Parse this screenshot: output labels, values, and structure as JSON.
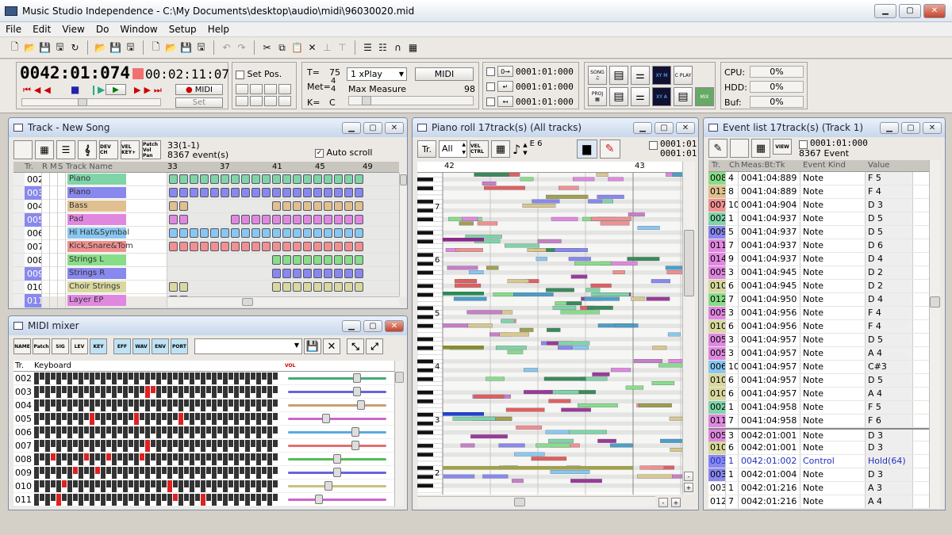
{
  "app": {
    "title": "Music Studio Independence - C:\\My Documents\\desktop\\audio\\midi\\96030020.mid",
    "menu": [
      "File",
      "Edit",
      "View",
      "Do",
      "Window",
      "Setup",
      "Help"
    ]
  },
  "transport": {
    "position": "0042:01:074",
    "time": "00:02:11:07",
    "midi_label": "MIDI",
    "set_label": "Set",
    "set_pos_label": "Set Pos.",
    "tempo_label": "T=",
    "tempo": "75",
    "meter_label": "Met=",
    "meter_top": "4",
    "meter_bottom": "4",
    "key_label": "K=",
    "key": "C",
    "play_mode": "1 xPlay",
    "midi_button": "MIDI",
    "max_measure_label": "Max Measure",
    "max_measure": "98",
    "loc1": "0001:01:000",
    "loc2": "0001:01:000",
    "loc3": "0001:01:000",
    "cpu_label": "CPU:",
    "cpu": "0%",
    "hdd_label": "HDD:",
    "hdd": "0%",
    "buf_label": "Buf:",
    "buf": "0%",
    "view_buttons": [
      "SONG",
      "PROJ",
      "C PLAY",
      "XY M",
      "XY A",
      "MIX"
    ]
  },
  "track_window": {
    "title": "Track - New Song",
    "position": "33(1-1)",
    "events": "8367 event(s)",
    "auto_scroll": "Auto scroll",
    "tool_buttons": [
      "DEV CH",
      "VEL KEY+",
      "Patch Vol Pan"
    ],
    "columns": [
      "Tr.",
      "R",
      "M",
      "S",
      "Track Name"
    ],
    "measures": [
      "33",
      "37",
      "41",
      "45",
      "49"
    ],
    "tracks": [
      {
        "no": "002",
        "name": "Piano",
        "color": "#7fd4a8",
        "sel": false
      },
      {
        "no": "003",
        "name": "Piano",
        "color": "#8888ee",
        "sel": true
      },
      {
        "no": "004",
        "name": "Bass",
        "color": "#e0c090",
        "sel": false
      },
      {
        "no": "005",
        "name": "Pad",
        "color": "#e088e0",
        "sel": true
      },
      {
        "no": "006",
        "name": "Hi Hat&Symbal",
        "color": "#88c8f0",
        "sel": false
      },
      {
        "no": "007",
        "name": "Kick,Snare&Tom",
        "color": "#f09090",
        "sel": false
      },
      {
        "no": "008",
        "name": "Strings L",
        "color": "#88dd88",
        "sel": false
      },
      {
        "no": "009",
        "name": "Strings R",
        "color": "#8888ee",
        "sel": true
      },
      {
        "no": "010",
        "name": "Choir Strings",
        "color": "#d8d8a0",
        "sel": false
      },
      {
        "no": "011",
        "name": "Layer EP",
        "color": "#e088e0",
        "sel": true
      }
    ]
  },
  "mixer": {
    "title": "MIDI mixer",
    "buttons": [
      "NAME",
      "Patch",
      "SIG",
      "LEV",
      "KEY",
      "EFF",
      "WAV",
      "ENV",
      "PORT"
    ],
    "columns": [
      "Tr.",
      "Keyboard"
    ],
    "vol_label": "VOL",
    "tracks": [
      "002",
      "003",
      "004",
      "005",
      "006",
      "007",
      "008",
      "009",
      "010",
      "011"
    ],
    "faders": [
      {
        "color": "#44aa77",
        "level": 0.72
      },
      {
        "color": "#6666dd",
        "level": 0.72
      },
      {
        "color": "#c8a070",
        "level": 0.76
      },
      {
        "color": "#cc66cc",
        "level": 0.38
      },
      {
        "color": "#5aaae0",
        "level": 0.7
      },
      {
        "color": "#e07070",
        "level": 0.7
      },
      {
        "color": "#55bb55",
        "level": 0.5
      },
      {
        "color": "#6666dd",
        "level": 0.5
      },
      {
        "color": "#c8c080",
        "level": 0.4
      },
      {
        "color": "#cc66cc",
        "level": 0.3
      }
    ]
  },
  "piano_roll": {
    "title": "Piano roll 17track(s) (All tracks)",
    "track_button": "Tr.",
    "filter": "All",
    "note": "E 6",
    "pos1": "0001:01:",
    "pos2": "0001:01:",
    "measures": [
      "42",
      "43"
    ],
    "octaves": [
      "7",
      "6",
      "5",
      "4",
      "3",
      "2"
    ]
  },
  "event_list": {
    "title": "Event list 17track(s) (Track 1)",
    "position": "0001:01:000",
    "count": "8367 Event",
    "view_label": "VIEW",
    "columns": [
      "Tr.",
      "Ch",
      "Meas:Bt:Tk",
      "Event Kind",
      "Value"
    ],
    "rows": [
      {
        "tr": "008",
        "ch": "4",
        "time": "0041:04:889",
        "kind": "Note",
        "value": "F 5",
        "color": "#88dd88"
      },
      {
        "tr": "013",
        "ch": "8",
        "time": "0041:04:889",
        "kind": "Note",
        "value": "F 4",
        "color": "#e0c090"
      },
      {
        "tr": "007",
        "ch": "10",
        "time": "0041:04:904",
        "kind": "Note",
        "value": "D 3",
        "color": "#f09090"
      },
      {
        "tr": "002",
        "ch": "1",
        "time": "0041:04:937",
        "kind": "Note",
        "value": "D 5",
        "color": "#7fd4a8"
      },
      {
        "tr": "009",
        "ch": "5",
        "time": "0041:04:937",
        "kind": "Note",
        "value": "D 5",
        "color": "#8888ee"
      },
      {
        "tr": "011",
        "ch": "7",
        "time": "0041:04:937",
        "kind": "Note",
        "value": "D 6",
        "color": "#e088e0"
      },
      {
        "tr": "014",
        "ch": "9",
        "time": "0041:04:937",
        "kind": "Note",
        "value": "D 4",
        "color": "#e088e0"
      },
      {
        "tr": "005",
        "ch": "3",
        "time": "0041:04:945",
        "kind": "Note",
        "value": "D 2",
        "color": "#e088e0"
      },
      {
        "tr": "010",
        "ch": "6",
        "time": "0041:04:945",
        "kind": "Note",
        "value": "D 2",
        "color": "#d8d8a0"
      },
      {
        "tr": "012",
        "ch": "7",
        "time": "0041:04:950",
        "kind": "Note",
        "value": "D 4",
        "color": "#88dd88"
      },
      {
        "tr": "005",
        "ch": "3",
        "time": "0041:04:956",
        "kind": "Note",
        "value": "F 4",
        "color": "#e088e0"
      },
      {
        "tr": "010",
        "ch": "6",
        "time": "0041:04:956",
        "kind": "Note",
        "value": "F 4",
        "color": "#d8d8a0"
      },
      {
        "tr": "005",
        "ch": "3",
        "time": "0041:04:957",
        "kind": "Note",
        "value": "D 5",
        "color": "#e088e0"
      },
      {
        "tr": "005",
        "ch": "3",
        "time": "0041:04:957",
        "kind": "Note",
        "value": "A 4",
        "color": "#e088e0"
      },
      {
        "tr": "006",
        "ch": "10",
        "time": "0041:04:957",
        "kind": "Note",
        "value": "C#3",
        "color": "#88c8f0"
      },
      {
        "tr": "010",
        "ch": "6",
        "time": "0041:04:957",
        "kind": "Note",
        "value": "D 5",
        "color": "#d8d8a0"
      },
      {
        "tr": "010",
        "ch": "6",
        "time": "0041:04:957",
        "kind": "Note",
        "value": "A 4",
        "color": "#d8d8a0"
      },
      {
        "tr": "002",
        "ch": "1",
        "time": "0041:04:958",
        "kind": "Note",
        "value": "F 5",
        "color": "#7fd4a8"
      },
      {
        "tr": "011",
        "ch": "7",
        "time": "0041:04:958",
        "kind": "Note",
        "value": "F 6",
        "color": "#e088e0"
      },
      {
        "tr": "005",
        "ch": "3",
        "time": "0042:01:001",
        "kind": "Note",
        "value": "D 3",
        "color": "#e088e0"
      },
      {
        "tr": "010",
        "ch": "6",
        "time": "0042:01:001",
        "kind": "Note",
        "value": "D 3",
        "color": "#d8d8a0"
      },
      {
        "tr": "003",
        "ch": "1",
        "time": "0042:01:002",
        "kind": "Control",
        "value": "Hold(64)",
        "color": "#8888ee"
      },
      {
        "tr": "003",
        "ch": "1",
        "time": "0042:01:004",
        "kind": "Note",
        "value": "D 3",
        "color": "#8888ee"
      },
      {
        "tr": "003",
        "ch": "1",
        "time": "0042:01:216",
        "kind": "Note",
        "value": "A 3",
        "color": "#ffffff"
      },
      {
        "tr": "012",
        "ch": "7",
        "time": "0042:01:216",
        "kind": "Note",
        "value": "A 4",
        "color": "#ffffff"
      }
    ]
  }
}
